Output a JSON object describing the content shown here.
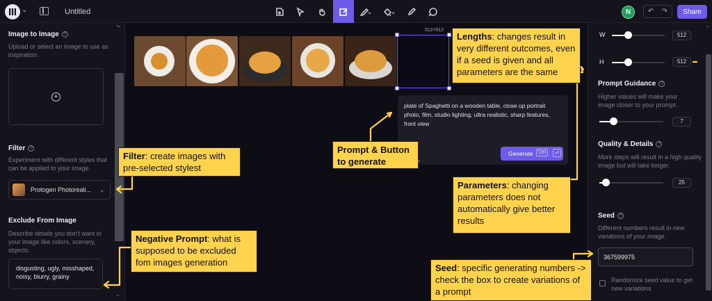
{
  "topbar": {
    "doc_title": "Untitled",
    "avatar_initial": "N",
    "share_label": "Share",
    "tools": [
      "import-icon",
      "select-icon",
      "hand-icon",
      "edit-image-icon",
      "brush-icon",
      "fill-icon",
      "pen-icon",
      "comment-icon"
    ]
  },
  "left_panel": {
    "image_to_image": {
      "title": "Image to Image",
      "desc": "Upload or select an image to use as inspiration."
    },
    "filter": {
      "title": "Filter",
      "desc": "Experiment with different styles that can be applied to your image.",
      "selected": "Protogen Photoreali..."
    },
    "exclude": {
      "title": "Exclude From Image",
      "desc": "Describe details you don't want in your image like colors, scenery, objects.",
      "value": "disgusting, ugly, misshaped, noisy, blurry, grainy"
    }
  },
  "canvas": {
    "dim_label": "512×512",
    "prompt": "plate of Spaghetti on a wooden table, close up portrait photo, film, studio lighting, ultra realistic, sharp features, front view",
    "generate_label": "Generate",
    "shortcut_1": "Ctrl",
    "shortcut_2": "⏎"
  },
  "right_panel": {
    "width_label": "W",
    "width_value": "512",
    "height_label": "H",
    "height_value": "512",
    "prompt_guidance": {
      "title": "Prompt Guidance",
      "desc": "Higher values will make your image closer to your prompt.",
      "value": "7"
    },
    "quality": {
      "title": "Quality & Details",
      "desc": "More steps will result in a high quality image but will take longer.",
      "value": "25"
    },
    "seed": {
      "title": "Seed",
      "desc": "Different numbers result in new variations of your image.",
      "value": "367599975",
      "randomize_label": "Randomize seed value to get new variations"
    }
  },
  "annotations": {
    "lengths": {
      "bold": "Lengths",
      "text": ": changes result in very different outcomes, even if a seed is given and all parameters are the same"
    },
    "filter": {
      "bold": "Filter",
      "text": ": create images with pre-selected stylest"
    },
    "prompt": {
      "bold": "Prompt & Button to generate",
      "text": ""
    },
    "parameters": {
      "bold": "Parameters",
      "text": ": changing parameters does not automatically give better results"
    },
    "negative": {
      "bold": "Negative Prompt",
      "text": ": what is supposed to be excluded fom images generation"
    },
    "seed": {
      "bold": "Seed",
      "text": ": specific generating numbers -> check the box to create variations of a prompt"
    }
  },
  "colors": {
    "accent": "#6d5ce8",
    "note_bg": "#ffd34e",
    "panel_bg": "#15141c"
  }
}
